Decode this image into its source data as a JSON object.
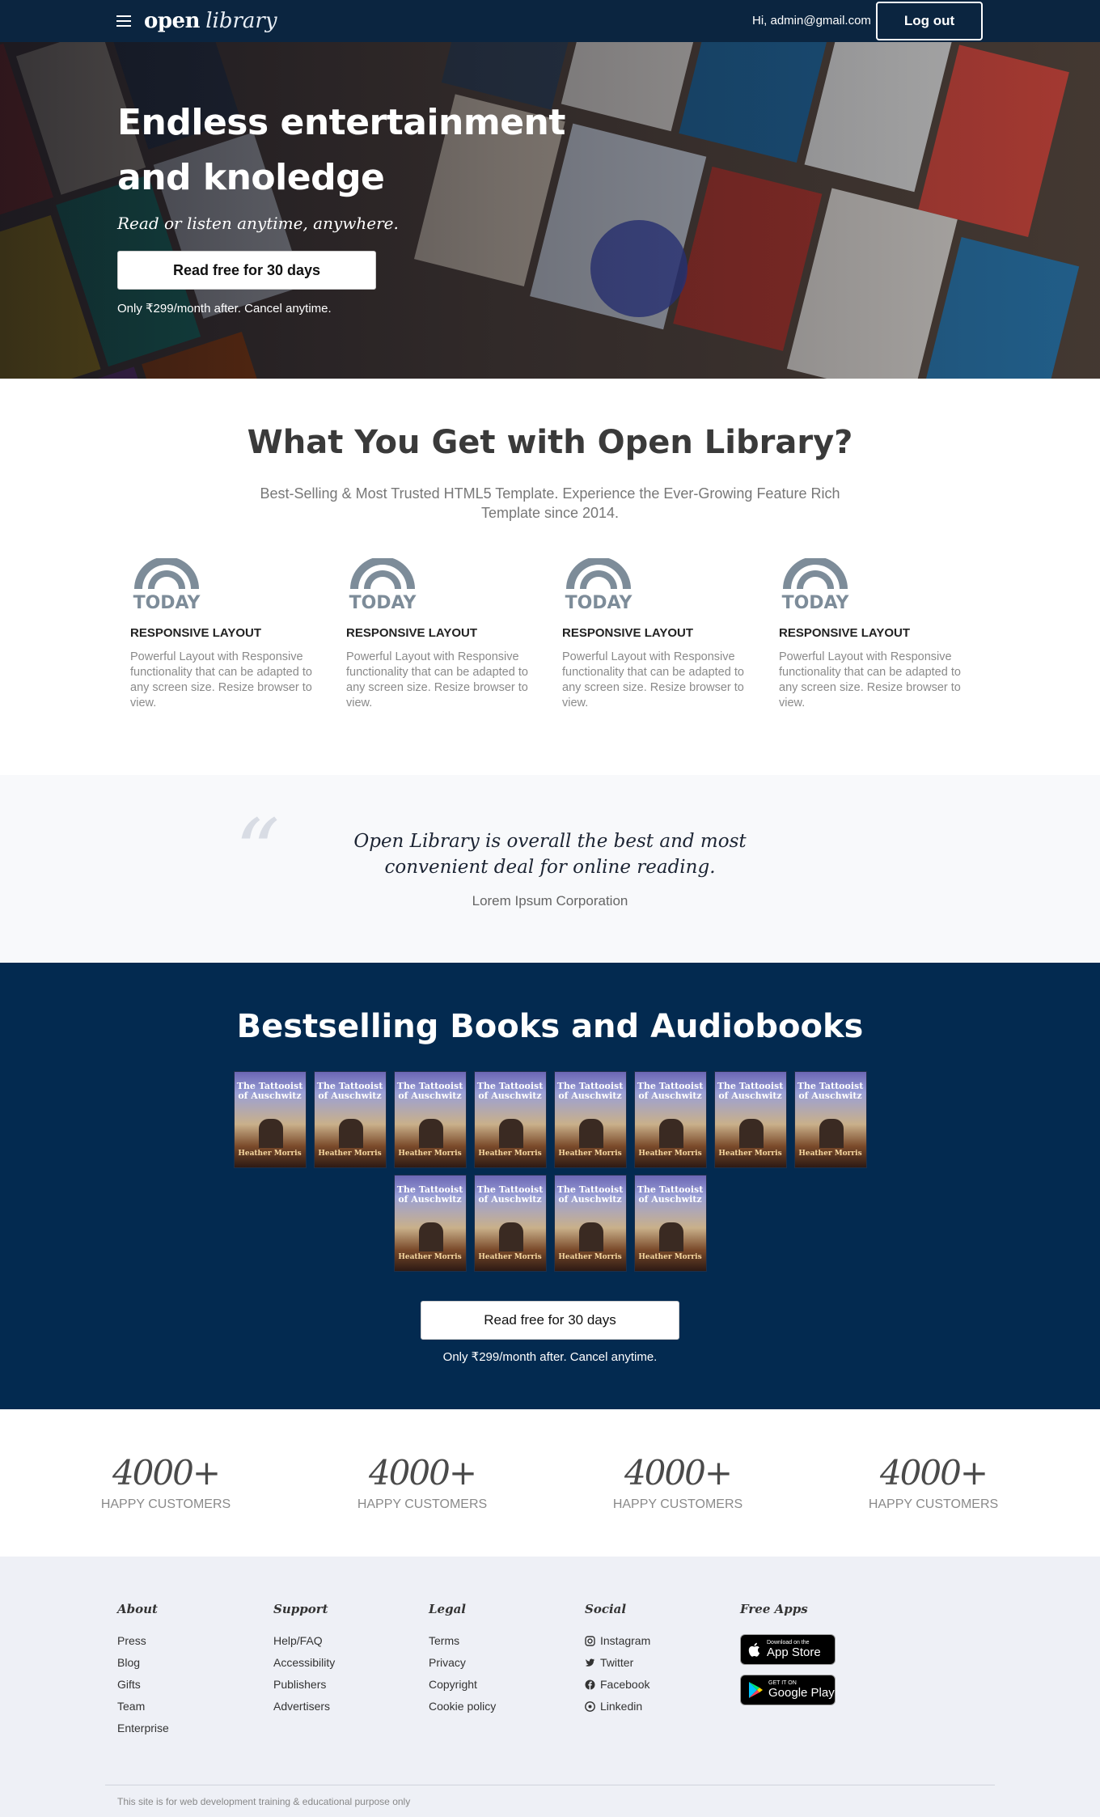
{
  "nav": {
    "logo_bold": "open",
    "logo_italic": "library",
    "greeting": "Hi, admin@gmail.com",
    "logout_label": "Log out"
  },
  "hero": {
    "title_line1": "Endless entertainment",
    "title_line2": "and knoledge",
    "subtitle": "Read or listen anytime, anywhere.",
    "cta_label": "Read free for 30 days",
    "note": "Only ₹299/month after. Cancel anytime."
  },
  "features": {
    "title": "What You Get with Open Library?",
    "subtitle": "Best-Selling & Most Trusted HTML5 Template. Experience the Ever-Growing Feature Rich Template since 2014.",
    "icon_text": "TODAY",
    "cards": [
      {
        "heading": "RESPONSIVE LAYOUT",
        "text": "Powerful Layout with Responsive functionality that can be adapted to any screen size. Resize browser to view."
      },
      {
        "heading": "RESPONSIVE LAYOUT",
        "text": "Powerful Layout with Responsive functionality that can be adapted to any screen size. Resize browser to view."
      },
      {
        "heading": "RESPONSIVE LAYOUT",
        "text": "Powerful Layout with Responsive functionality that can be adapted to any screen size. Resize browser to view."
      },
      {
        "heading": "RESPONSIVE LAYOUT",
        "text": "Powerful Layout with Responsive functionality that can be adapted to any screen size. Resize browser to view."
      }
    ]
  },
  "quote": {
    "mark": "“",
    "text": "Open Library is overall the best and most convenient deal for online reading.",
    "author": "Lorem Ipsum Corporation"
  },
  "bestsellers": {
    "title": "Bestselling Books and Audiobooks",
    "book_title": "The Tattooist of Auschwitz",
    "book_author": "Heather Morris",
    "book_count": 12,
    "cta_label": "Read free for 30 days",
    "note": "Only ₹299/month after. Cancel anytime."
  },
  "stats": [
    {
      "number": "4000+",
      "label": "HAPPY CUSTOMERS"
    },
    {
      "number": "4000+",
      "label": "HAPPY CUSTOMERS"
    },
    {
      "number": "4000+",
      "label": "HAPPY CUSTOMERS"
    },
    {
      "number": "4000+",
      "label": "HAPPY CUSTOMERS"
    }
  ],
  "footer": {
    "columns": [
      {
        "heading": "About",
        "links": [
          "Press",
          "Blog",
          "Gifts",
          "Team",
          "Enterprise"
        ]
      },
      {
        "heading": "Support",
        "links": [
          "Help/FAQ",
          "Accessibility",
          "Publishers",
          "Advertisers"
        ]
      },
      {
        "heading": "Legal",
        "links": [
          "Terms",
          "Privacy",
          "Copyright",
          "Cookie policy"
        ]
      },
      {
        "heading": "Social",
        "links": [
          "Instagram",
          "Twitter",
          "Facebook",
          "Linkedin"
        ]
      }
    ],
    "apps_heading": "Free Apps",
    "appstore_small": "Download on the",
    "appstore_big": "App Store",
    "googleplay_small": "GET IT ON",
    "googleplay_big": "Google Play",
    "copyright": "This site is for web development training & educational purpose only"
  },
  "colors": {
    "nav_bg": "#0b2540",
    "bestseller_bg": "#032a50",
    "footer_bg": "#eef0f6",
    "icon_gray": "#7d8c99"
  },
  "icons": [
    "menu-icon",
    "today-logo-icon",
    "quote-mark-icon",
    "instagram-icon",
    "twitter-icon",
    "facebook-icon",
    "linkedin-icon",
    "apple-icon",
    "google-play-icon"
  ]
}
